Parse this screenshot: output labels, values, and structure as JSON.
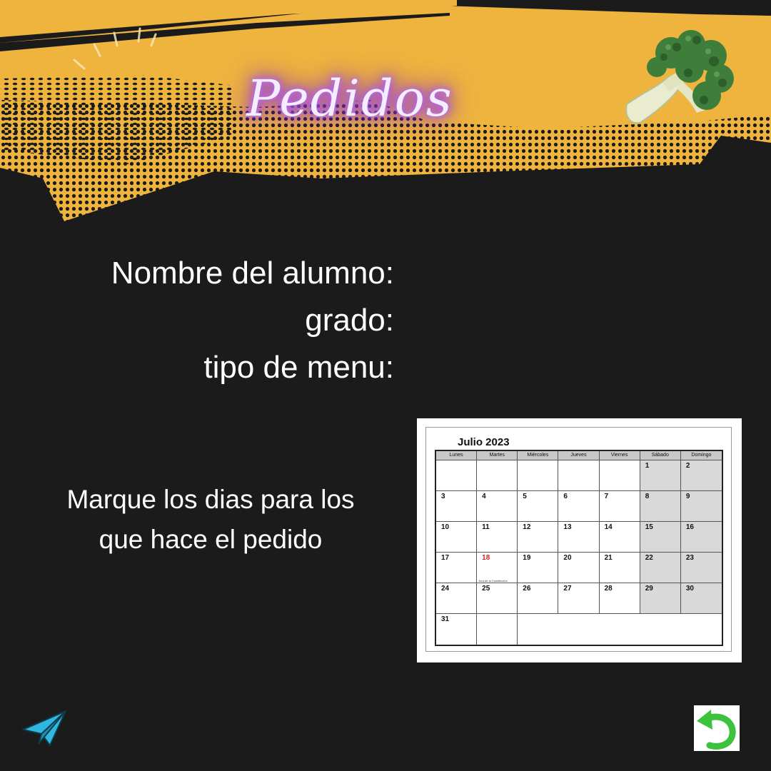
{
  "header": {
    "title": "Pedidos"
  },
  "form": {
    "labels": [
      "Nombre del alumno:",
      "grado:",
      "tipo de menu:"
    ]
  },
  "instruction": {
    "line1": "Marque los dias para los",
    "line2": "que hace el pedido"
  },
  "calendar": {
    "title": "Julio 2023",
    "weekdays": [
      "Lunes",
      "Martes",
      "Miércoles",
      "Jueves",
      "Viernes",
      "Sábado",
      "Domingo"
    ],
    "weeks": [
      [
        "",
        "",
        "",
        "",
        "",
        "1",
        "2"
      ],
      [
        "3",
        "4",
        "5",
        "6",
        "7",
        "8",
        "9"
      ],
      [
        "10",
        "11",
        "12",
        "13",
        "14",
        "15",
        "16"
      ],
      [
        "17",
        "18",
        "19",
        "20",
        "21",
        "22",
        "23"
      ],
      [
        "24",
        "25",
        "26",
        "27",
        "28",
        "29",
        "30"
      ],
      [
        "31"
      ]
    ],
    "holiday_day": "18",
    "holiday_note": "Jura de la Constitución"
  },
  "icons": {
    "send": "paper-plane-icon",
    "back": "undo-arrow-icon",
    "decoration": "broccoli-icon"
  },
  "colors": {
    "background": "#1c1b1c",
    "banner": "#eeb43e",
    "neon": "#a24bff",
    "send_icon": "#2fb7e0",
    "back_icon": "#3cc23c",
    "holiday": "#e02020"
  }
}
